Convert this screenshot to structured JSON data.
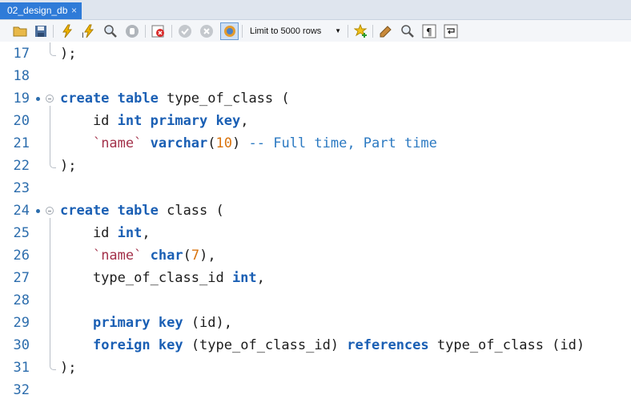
{
  "tab": {
    "title": "02_design_db",
    "close": "×"
  },
  "toolbar": {
    "icons": [
      "folder-open-icon",
      "save-icon",
      "execute-icon",
      "execute-current-icon",
      "explain-icon",
      "stop-icon",
      "toggle-error-icon",
      "commit-icon",
      "rollback-icon",
      "autocommit-icon",
      "add-snippet-icon",
      "beautify-icon",
      "find-icon",
      "invisible-chars-icon",
      "wrap-icon"
    ],
    "limit": "Limit to 5000 rows",
    "limit_arrow": "▼"
  },
  "editor": {
    "lines": [
      {
        "n": "17",
        "seg": [
          [
            "",
            ");"
          ]
        ]
      },
      {
        "n": "18",
        "seg": []
      },
      {
        "n": "19",
        "seg": [
          [
            "kw",
            "create"
          ],
          [
            "",
            " "
          ],
          [
            "kw",
            "table"
          ],
          [
            "",
            " type_of_class ("
          ]
        ]
      },
      {
        "n": "20",
        "seg": [
          [
            "",
            "    id "
          ],
          [
            "kw",
            "int"
          ],
          [
            "",
            " "
          ],
          [
            "kw",
            "primary"
          ],
          [
            "",
            " "
          ],
          [
            "kw",
            "key"
          ],
          [
            "",
            ","
          ]
        ]
      },
      {
        "n": "21",
        "seg": [
          [
            "",
            "    "
          ],
          [
            "str",
            "`name`"
          ],
          [
            "",
            " "
          ],
          [
            "kw",
            "varchar"
          ],
          [
            "",
            "("
          ],
          [
            "num",
            "10"
          ],
          [
            "",
            ") "
          ],
          [
            "cmt",
            "-- Full time, Part time"
          ]
        ]
      },
      {
        "n": "22",
        "seg": [
          [
            "",
            ");"
          ]
        ]
      },
      {
        "n": "23",
        "seg": []
      },
      {
        "n": "24",
        "seg": [
          [
            "kw",
            "create"
          ],
          [
            "",
            " "
          ],
          [
            "kw",
            "table"
          ],
          [
            "",
            " class ("
          ]
        ]
      },
      {
        "n": "25",
        "seg": [
          [
            "",
            "    id "
          ],
          [
            "kw",
            "int"
          ],
          [
            "",
            ","
          ]
        ]
      },
      {
        "n": "26",
        "seg": [
          [
            "",
            "    "
          ],
          [
            "str",
            "`name`"
          ],
          [
            "",
            " "
          ],
          [
            "kw",
            "char"
          ],
          [
            "",
            "("
          ],
          [
            "num",
            "7"
          ],
          [
            "",
            "),"
          ]
        ]
      },
      {
        "n": "27",
        "seg": [
          [
            "",
            "    type_of_class_id "
          ],
          [
            "kw",
            "int"
          ],
          [
            "",
            ","
          ]
        ]
      },
      {
        "n": "28",
        "seg": []
      },
      {
        "n": "29",
        "seg": [
          [
            "",
            "    "
          ],
          [
            "kw",
            "primary"
          ],
          [
            "",
            " "
          ],
          [
            "kw",
            "key"
          ],
          [
            "",
            " (id),"
          ]
        ]
      },
      {
        "n": "30",
        "seg": [
          [
            "",
            "    "
          ],
          [
            "kw",
            "foreign"
          ],
          [
            "",
            " "
          ],
          [
            "kw",
            "key"
          ],
          [
            "",
            " (type_of_class_id) "
          ],
          [
            "kw",
            "references"
          ],
          [
            "",
            " type_of_class (id)"
          ]
        ]
      },
      {
        "n": "31",
        "seg": [
          [
            "",
            ");"
          ]
        ]
      },
      {
        "n": "32",
        "seg": []
      }
    ]
  }
}
